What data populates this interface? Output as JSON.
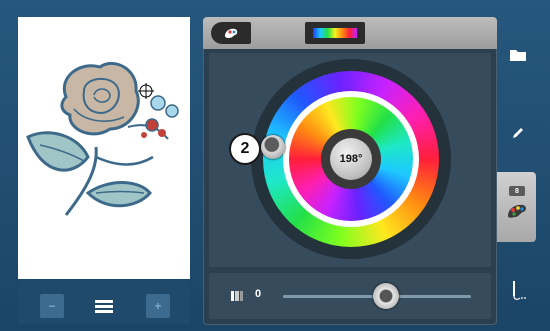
{
  "colors": {
    "background": "#1e4a6e",
    "panel": "#2a3f4f",
    "toolbar_top": "#b0b0b0",
    "preview_background": "#ffffff"
  },
  "left_bar": {
    "prev_icon": "minus-icon",
    "layers_icon": "layers-icon",
    "next_icon": "plus-icon"
  },
  "panel": {
    "top_tabs": [
      {
        "icon": "color-drop-icon"
      },
      {
        "icon": "rainbow-spectrum-icon"
      }
    ],
    "color_wheel": {
      "step_badge": "2",
      "hue_degree": "198°"
    },
    "brightness_slider": {
      "value": "0",
      "level": 0.55
    }
  },
  "right_toolbar": {
    "items": [
      {
        "icon": "folder-icon"
      },
      {
        "icon": "pencil-icon"
      },
      {
        "icon": "color-palette-icon",
        "badge": "8",
        "selected": true
      },
      {
        "icon": "needle-thread-icon"
      }
    ]
  }
}
